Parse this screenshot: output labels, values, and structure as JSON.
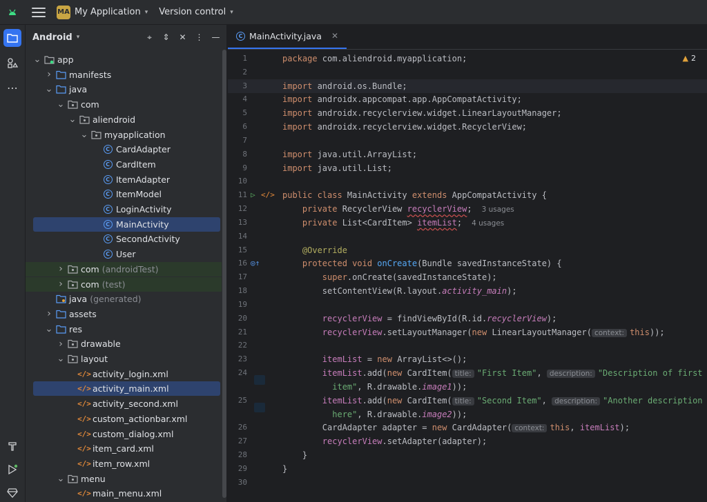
{
  "topbar": {
    "project_badge": "MA",
    "project_name": "My Application",
    "version_control": "Version control"
  },
  "panel": {
    "title": "Android",
    "tree": [
      {
        "label": "app",
        "depth": 0,
        "arrow": "open",
        "icon": "module"
      },
      {
        "label": "manifests",
        "depth": 1,
        "arrow": "closed",
        "icon": "folder"
      },
      {
        "label": "java",
        "depth": 1,
        "arrow": "open",
        "icon": "folder"
      },
      {
        "label": "com",
        "depth": 2,
        "arrow": "open",
        "icon": "package"
      },
      {
        "label": "aliendroid",
        "depth": 3,
        "arrow": "open",
        "icon": "package"
      },
      {
        "label": "myapplication",
        "depth": 4,
        "arrow": "open",
        "icon": "package"
      },
      {
        "label": "CardAdapter",
        "depth": 5,
        "arrow": "none",
        "icon": "class"
      },
      {
        "label": "CardItem",
        "depth": 5,
        "arrow": "none",
        "icon": "class"
      },
      {
        "label": "ItemAdapter",
        "depth": 5,
        "arrow": "none",
        "icon": "class"
      },
      {
        "label": "ItemModel",
        "depth": 5,
        "arrow": "none",
        "icon": "class"
      },
      {
        "label": "LoginActivity",
        "depth": 5,
        "arrow": "none",
        "icon": "class"
      },
      {
        "label": "MainActivity",
        "depth": 5,
        "arrow": "none",
        "icon": "class",
        "selected": true
      },
      {
        "label": "SecondActivity",
        "depth": 5,
        "arrow": "none",
        "icon": "class"
      },
      {
        "label": "User",
        "depth": 5,
        "arrow": "none",
        "icon": "class"
      },
      {
        "label": "com",
        "suffix": "(androidTest)",
        "depth": 2,
        "arrow": "closed",
        "icon": "package",
        "green": true
      },
      {
        "label": "com",
        "suffix": "(test)",
        "depth": 2,
        "arrow": "closed",
        "icon": "package",
        "green": true
      },
      {
        "label": "java",
        "suffix": "(generated)",
        "depth": 1,
        "arrow": "none",
        "icon": "folder-gen"
      },
      {
        "label": "assets",
        "depth": 1,
        "arrow": "closed",
        "icon": "folder"
      },
      {
        "label": "res",
        "depth": 1,
        "arrow": "open",
        "icon": "folder"
      },
      {
        "label": "drawable",
        "depth": 2,
        "arrow": "closed",
        "icon": "package"
      },
      {
        "label": "layout",
        "depth": 2,
        "arrow": "open",
        "icon": "package"
      },
      {
        "label": "activity_login.xml",
        "depth": 3,
        "arrow": "none",
        "icon": "xml"
      },
      {
        "label": "activity_main.xml",
        "depth": 3,
        "arrow": "none",
        "icon": "xml",
        "selected": true
      },
      {
        "label": "activity_second.xml",
        "depth": 3,
        "arrow": "none",
        "icon": "xml"
      },
      {
        "label": "custom_actionbar.xml",
        "depth": 3,
        "arrow": "none",
        "icon": "xml"
      },
      {
        "label": "custom_dialog.xml",
        "depth": 3,
        "arrow": "none",
        "icon": "xml"
      },
      {
        "label": "item_card.xml",
        "depth": 3,
        "arrow": "none",
        "icon": "xml"
      },
      {
        "label": "item_row.xml",
        "depth": 3,
        "arrow": "none",
        "icon": "xml"
      },
      {
        "label": "menu",
        "depth": 2,
        "arrow": "open",
        "icon": "package"
      },
      {
        "label": "main_menu.xml",
        "depth": 3,
        "arrow": "none",
        "icon": "xml"
      }
    ]
  },
  "editor": {
    "tab_label": "MainActivity.java",
    "warning_count": "2",
    "line_numbers": [
      "1",
      "2",
      "3",
      "4",
      "5",
      "6",
      "7",
      "8",
      "9",
      "10",
      "11",
      "12",
      "13",
      "14",
      "15",
      "16",
      "17",
      "18",
      "19",
      "20",
      "21",
      "22",
      "23",
      "24",
      "",
      "25",
      "",
      "26",
      "27",
      "28",
      "29",
      "30"
    ],
    "code": {
      "l1": [
        "package",
        " com.aliendroid.myapplication;"
      ],
      "l3": [
        "import",
        " android.os.Bundle;"
      ],
      "l4": [
        "import",
        " androidx.appcompat.app.AppCompatActivity;"
      ],
      "l5": [
        "import",
        " androidx.recyclerview.widget.LinearLayoutManager;"
      ],
      "l6": [
        "import",
        " androidx.recyclerview.widget.RecyclerView;"
      ],
      "l8": [
        "import",
        " java.util.ArrayList;"
      ],
      "l9": [
        "import",
        " java.util.List;"
      ],
      "l11": [
        "public class",
        " MainActivity ",
        "extends",
        " AppCompatActivity {"
      ],
      "l12": [
        "    private",
        " RecyclerView ",
        "recyclerView",
        ";",
        "3 usages"
      ],
      "l13": [
        "    private",
        " List<CardItem> ",
        "itemList",
        ";",
        "4 usages"
      ],
      "l15": [
        "    @Override"
      ],
      "l16": [
        "    protected void",
        " ",
        "onCreate",
        "(Bundle savedInstanceState) {"
      ],
      "l17": [
        "        super",
        ".onCreate(savedInstanceState);"
      ],
      "l18": [
        "        setContentView(R.layout.",
        "activity_main",
        ");"
      ],
      "l20": [
        "        ",
        "recyclerView",
        " = findViewById(R.id.",
        "recyclerView",
        ");"
      ],
      "l21": [
        "        ",
        "recyclerView",
        ".setLayoutManager(",
        "new",
        " LinearLayoutManager(",
        "context:",
        "this",
        "));"
      ],
      "l23": [
        "        ",
        "itemList",
        " = ",
        "new",
        " ArrayList<>();"
      ],
      "l24": [
        "        ",
        "itemList",
        ".add(",
        "new",
        " CardItem(",
        "title:",
        "\"First Item\"",
        ", ",
        "description:",
        "\"Description of first"
      ],
      "l24b": [
        "          item\"",
        ", R.drawable.",
        "image1",
        "));"
      ],
      "l25": [
        "        ",
        "itemList",
        ".add(",
        "new",
        " CardItem(",
        "title:",
        "\"Second Item\"",
        ", ",
        "description:",
        "\"Another description"
      ],
      "l25b": [
        "          here\"",
        ", R.drawable.",
        "image2",
        "));"
      ],
      "l27": [
        "        CardAdapter adapter = ",
        "new",
        " CardAdapter(",
        "context:",
        "this",
        ", ",
        "itemList",
        ");"
      ],
      "l28": [
        "        ",
        "recyclerView",
        ".setAdapter(adapter);"
      ],
      "l29": [
        "    }"
      ],
      "l30": [
        "}"
      ]
    }
  },
  "colors": {
    "accent": "#3574f0",
    "selection": "#2e436e",
    "keyword": "#cf8e6d",
    "field": "#c77dbb",
    "string": "#6aab73"
  }
}
